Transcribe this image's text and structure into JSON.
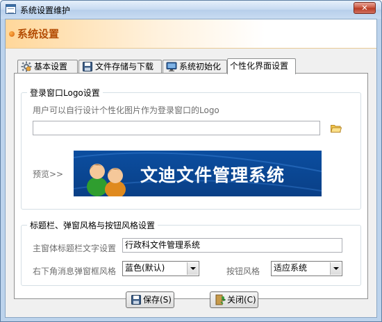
{
  "window": {
    "title": "系统设置维护",
    "close_label": "✕"
  },
  "header": {
    "title": "系统设置"
  },
  "tabs": [
    {
      "label": "基本设置",
      "icon": "gear-icon"
    },
    {
      "label": "文件存储与下载",
      "icon": "save-icon"
    },
    {
      "label": "系统初始化",
      "icon": "monitor-icon"
    },
    {
      "label": "个性化界面设置",
      "icon": "",
      "active": true
    }
  ],
  "logo_group": {
    "legend": "登录窗口Logo设置",
    "hint": "用户可以自行设计个性化图片作为登录窗口的Logo",
    "path_value": "",
    "preview_label": "预览>>",
    "banner_text": "文迪文件管理系统"
  },
  "style_group": {
    "legend": "标题栏、弹窗风格与按钮风格设置",
    "title_label": "主窗体标题栏文字设置",
    "title_value": "行政科文件管理系统",
    "popup_label": "右下角消息弹窗框风格",
    "popup_value": "蓝色(默认)",
    "button_style_label": "按钮风格",
    "button_style_value": "适应系统"
  },
  "buttons": {
    "save": "保存(S)",
    "close": "关闭(C)"
  },
  "colors": {
    "accent": "#b44d05",
    "banner": "#0b4ea0",
    "title_bar": "#c6daf1"
  }
}
